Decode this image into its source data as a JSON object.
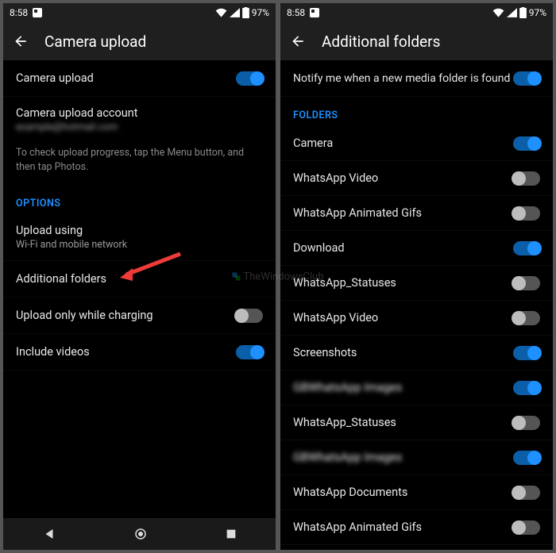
{
  "status": {
    "time": "8:58",
    "battery": "97%"
  },
  "left": {
    "title": "Camera upload",
    "rows": {
      "camera_upload": "Camera upload",
      "account_label": "Camera upload account",
      "account_value": "example@hotmail.com",
      "help": "To check upload progress, tap the Menu button, and then tap Photos.",
      "options_header": "OPTIONS",
      "upload_using": "Upload using",
      "upload_using_sub": "Wi-Fi and mobile network",
      "additional_folders": "Additional folders",
      "only_charging": "Upload only while charging",
      "include_videos": "Include videos"
    },
    "toggles": {
      "camera_upload": true,
      "only_charging": false,
      "include_videos": true
    }
  },
  "right": {
    "title": "Additional folders",
    "notify": "Notify me when a new media folder is found",
    "notify_on": true,
    "folders_header": "FOLDERS",
    "folders": [
      {
        "name": "Camera",
        "on": true
      },
      {
        "name": "WhatsApp Video",
        "on": false
      },
      {
        "name": "WhatsApp Animated Gifs",
        "on": false
      },
      {
        "name": "Download",
        "on": true
      },
      {
        "name": "WhatsApp_Statuses",
        "on": false
      },
      {
        "name": "WhatsApp Video",
        "on": false
      },
      {
        "name": "Screenshots",
        "on": true
      },
      {
        "name": "GBWhatsApp Images",
        "on": true,
        "blur": true
      },
      {
        "name": "WhatsApp_Statuses",
        "on": false
      },
      {
        "name": "GBWhatsApp Images",
        "on": true,
        "blur": true
      },
      {
        "name": "WhatsApp Documents",
        "on": false
      },
      {
        "name": "WhatsApp Animated Gifs",
        "on": false
      }
    ]
  },
  "watermark": "TheWindowsClub"
}
